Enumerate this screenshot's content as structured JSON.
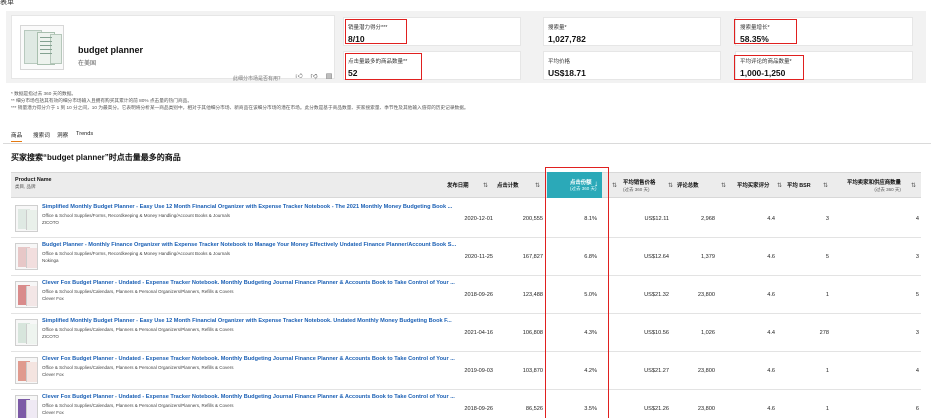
{
  "top_cut_text": "表单",
  "product": {
    "title": "budget planner",
    "market": "在美国",
    "feedback_prompt": "此细分市场是否有用？"
  },
  "metrics": {
    "niche_score": {
      "label": "销量潜力得分***",
      "value": "8/10"
    },
    "search_volume": {
      "label": "搜索量*",
      "value": "1,027,782"
    },
    "search_growth": {
      "label": "搜索量增长*",
      "value": "58.35%"
    },
    "top_clicked_products": {
      "label": "点击量最多的商品数量**",
      "value": "52"
    },
    "avg_price": {
      "label": "平均价格",
      "value": "US$18.71"
    },
    "avg_review_count": {
      "label": "平均评论的商品数量*",
      "value": "1,000-1,250"
    }
  },
  "notes": [
    "* 数据是指过去 360 天的数据。",
    "** 细分市场包括其有效的细分市场输入且拥有购买其累计的前 80% 点击量的热门商品。",
    "*** 销量潜力得分介于 1 到 10 分之间，10 为最高分。它表明将分析某一商品类别中，相对于其他细分市场、新商品在该细分市场的潜在市场。此分数是基于商品数量、买家搜索量、季节性及其他输入值得的历史记录数据。"
  ],
  "tabs": [
    "商品",
    "搜索词",
    "洞察",
    "Trends"
  ],
  "section_title": "买家搜索“budget planner”时点击量最多的商品",
  "columns": {
    "product_name": "Product Name",
    "product_sub": "类目, 品牌",
    "launch_date": "发布日期",
    "clicks": "点击计数",
    "click_share": "点击份额",
    "click_share_sub": "(过去 360 天)",
    "avg_price": "平均销售价格",
    "avg_price_sub": "(过去 360 天)",
    "review_count": "评论总数",
    "avg_rating": "平均买家评分",
    "avg_bsr": "平均 BSR",
    "avg_sellers": "平均卖家和供应商数量",
    "avg_sellers_sub": "(过去 360 天)"
  },
  "rows": [
    {
      "title": "Simplified Monthly Budget Planner - Easy Use 12 Month Financial Organizer with Expense Tracker Notebook - The 2021 Monthly Money Budgeting Book ...",
      "category": "Office & School Supplies/Forms, Recordkeeping & Money Handling/Account Books & Journals",
      "brand": "ZICOTO",
      "launch_date": "2020-12-01",
      "clicks": "200,555",
      "click_share": "8.1%",
      "avg_price": "US$12.11",
      "reviews": "2,968",
      "rating": "4.4",
      "bsr": "3",
      "sellers": "4"
    },
    {
      "title": "Budget Planner - Monthly Finance Organizer with Expense Tracker Notebook to Manage Your Money Effectively Undated Finance Planner/Account Book S...",
      "category": "Office & School Supplies/Forms, Recordkeeping & Money Handling/Account Books & Journals",
      "brand": "Nokinga",
      "launch_date": "2020-11-25",
      "clicks": "167,827",
      "click_share": "6.8%",
      "avg_price": "US$12.64",
      "reviews": "1,379",
      "rating": "4.6",
      "bsr": "5",
      "sellers": "3"
    },
    {
      "title": "Clever Fox Budget Planner - Undated - Expense Tracker Notebook. Monthly Budgeting Journal Finance Planner & Accounts Book to Take Control of Your ...",
      "category": "Office & School Supplies/Calendars, Planners & Personal Organizers/Planners, Refills & Covers",
      "brand": "Clever Fox",
      "launch_date": "2018-09-26",
      "clicks": "123,488",
      "click_share": "5.0%",
      "avg_price": "US$21.32",
      "reviews": "23,800",
      "rating": "4.6",
      "bsr": "1",
      "sellers": "5"
    },
    {
      "title": "Simplified Monthly Budget Planner - Easy Use 12 Month Financial Organizer with Expense Tracker Notebook. Undated Monthly Money Budgeting Book F...",
      "category": "Office & School Supplies/Calendars, Planners & Personal Organizers/Planners, Refills & Covers",
      "brand": "ZICOTO",
      "launch_date": "2021-04-16",
      "clicks": "106,808",
      "click_share": "4.3%",
      "avg_price": "US$10.56",
      "reviews": "1,026",
      "rating": "4.4",
      "bsr": "278",
      "sellers": "3"
    },
    {
      "title": "Clever Fox Budget Planner - Undated - Expense Tracker Notebook. Monthly Budgeting Journal Finance Planner & Accounts Book to Take Control of Your ...",
      "category": "Office & School Supplies/Calendars, Planners & Personal Organizers/Planners, Refills & Covers",
      "brand": "Clever Fox",
      "launch_date": "2019-09-03",
      "clicks": "103,870",
      "click_share": "4.2%",
      "avg_price": "US$21.27",
      "reviews": "23,800",
      "rating": "4.6",
      "bsr": "1",
      "sellers": "4"
    },
    {
      "title": "Clever Fox Budget Planner - Undated - Expense Tracker Notebook. Monthly Budgeting Journal Finance Planner & Accounts Book to Take Control of Your ...",
      "category": "Office & School Supplies/Calendars, Planners & Personal Organizers/Planners, Refills & Covers",
      "brand": "Clever Fox",
      "launch_date": "2018-09-26",
      "clicks": "86,526",
      "click_share": "3.5%",
      "avg_price": "US$21.26",
      "reviews": "23,800",
      "rating": "4.6",
      "bsr": "1",
      "sellers": "6"
    }
  ],
  "colors": {
    "highlight": "#e0201f",
    "active_column": "#2ba9b8",
    "link": "#1a5fb4",
    "tab_underline": "#e47911"
  },
  "thumb_colors": [
    [
      "#dfe9e3",
      "#e9f0ea"
    ],
    [
      "#e7c7c7",
      "#f2dede"
    ],
    [
      "#d98b8b",
      "#f3e6e6"
    ],
    [
      "#d7e5dc",
      "#eef4ef"
    ],
    [
      "#e09a8e",
      "#f4e4e0"
    ],
    [
      "#7c5aa6",
      "#efe9f4"
    ]
  ]
}
